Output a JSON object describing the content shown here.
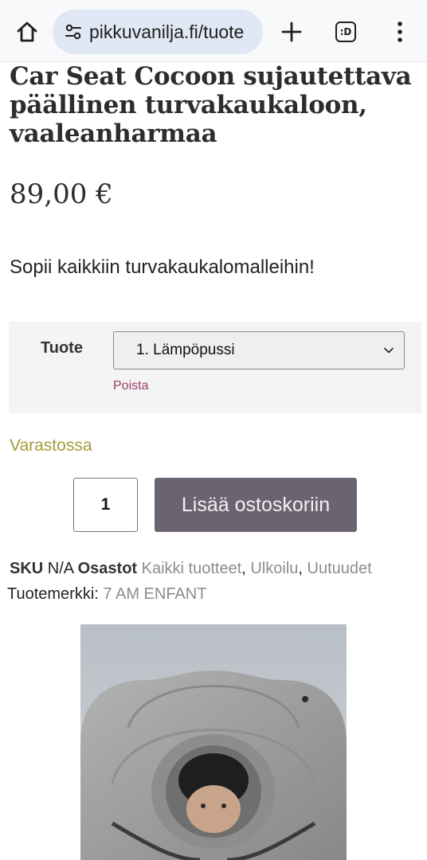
{
  "browser": {
    "url": "pikkuvanilja.fi/tuote",
    "tab_count_label": ":D",
    "icons": [
      "home-icon",
      "site-settings-icon",
      "new-tab-icon",
      "tab-switcher-icon",
      "more-vert-icon"
    ]
  },
  "product": {
    "title": "Car Seat Cocoon sujautettava päällinen turvakaukaloon, vaaleanharmaa",
    "price": "89,00 €",
    "tagline": "Sopii kaikkiin turvakaukalomalleihin!",
    "variation": {
      "label": "Tuote",
      "selected": "1. Lämpöpussi",
      "clear_label": "Poista"
    },
    "stock_status": "Varastossa",
    "quantity": "1",
    "add_to_cart_label": "Lisää ostoskoriin",
    "meta": {
      "sku_label": "SKU",
      "sku_value": "N/A",
      "categories_label": "Osastot",
      "categories": [
        "Kaikki tuotteet",
        "Ulkoilu",
        "Uutuudet"
      ],
      "separator": ", ",
      "brand_label": "Tuotemerkki:",
      "brand_value": "7 AM ENFANT"
    }
  },
  "colors": {
    "accent_button": "#6c6370",
    "stock_text": "#a49a3c",
    "clear_link": "#9c3f6a",
    "meta_link": "#8c8c8c",
    "url_bar": "#dfe8f4"
  }
}
